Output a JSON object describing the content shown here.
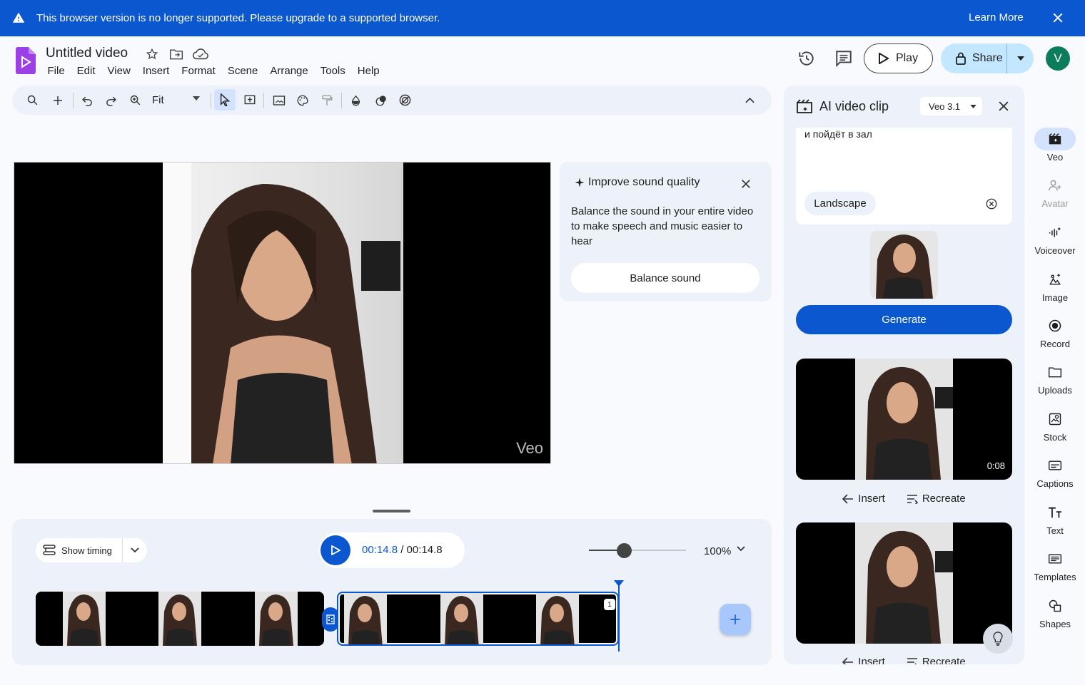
{
  "banner": {
    "message": "This browser version is no longer supported. Please upgrade to a supported browser.",
    "learn_more": "Learn More"
  },
  "header": {
    "title": "Untitled video",
    "menu": [
      "File",
      "Edit",
      "View",
      "Insert",
      "Format",
      "Scene",
      "Arrange",
      "Tools",
      "Help"
    ],
    "play_label": "Play",
    "share_label": "Share",
    "avatar_initial": "V"
  },
  "toolbar": {
    "zoom_value": "Fit"
  },
  "canvas": {
    "watermark": "Veo"
  },
  "sound_card": {
    "title": "Improve sound quality",
    "description": "Balance the sound in your entire video to make speech and music easier to hear",
    "button": "Balance sound"
  },
  "timeline": {
    "show_timing": "Show timing",
    "current_time": "00:14.8",
    "total_time": "/ 00:14.8",
    "zoom_percent": "100%",
    "zoom_level": 0.36,
    "clip2_badge": "1"
  },
  "panel": {
    "title": "AI video clip",
    "model": "Veo 3.1",
    "prompt_text": "и пойдёт в зал",
    "aspect_chip": "Landscape",
    "generate_label": "Generate",
    "results": [
      {
        "duration": "0:08",
        "insert": "Insert",
        "recreate": "Recreate"
      },
      {
        "insert": "Insert",
        "recreate": "Recreate"
      }
    ]
  },
  "rail": [
    {
      "label": "Veo",
      "icon": "veo-clapper-icon"
    },
    {
      "label": "Avatar",
      "icon": "avatar-icon"
    },
    {
      "label": "Voiceover",
      "icon": "voiceover-icon"
    },
    {
      "label": "Image",
      "icon": "image-sparkle-icon"
    },
    {
      "label": "Record",
      "icon": "record-icon"
    },
    {
      "label": "Uploads",
      "icon": "folder-icon"
    },
    {
      "label": "Stock",
      "icon": "stock-icon"
    },
    {
      "label": "Captions",
      "icon": "captions-icon"
    },
    {
      "label": "Text",
      "icon": "text-icon"
    },
    {
      "label": "Templates",
      "icon": "templates-icon"
    },
    {
      "label": "Shapes",
      "icon": "shapes-icon"
    }
  ],
  "colors": {
    "accent": "#0b57d0",
    "banner": "#0b57d0",
    "surface": "#edf2fa",
    "avatar_bg": "#0b7d5c"
  }
}
